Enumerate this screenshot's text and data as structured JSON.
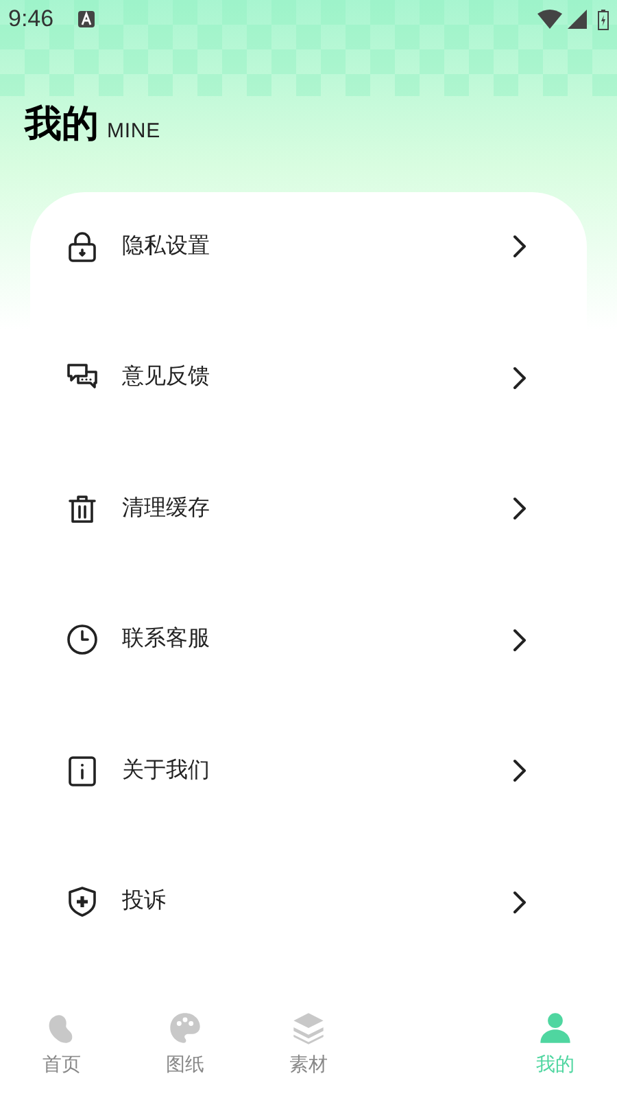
{
  "status_bar": {
    "time": "9:46"
  },
  "header": {
    "title": "我的",
    "subtitle": "MINE"
  },
  "menu": [
    {
      "label": "隐私设置"
    },
    {
      "label": "意见反馈"
    },
    {
      "label": "清理缓存"
    },
    {
      "label": "联系客服"
    },
    {
      "label": "关于我们"
    },
    {
      "label": "投诉"
    }
  ],
  "tab_bar": [
    {
      "label": "首页",
      "selected": false
    },
    {
      "label": "图纸",
      "selected": false
    },
    {
      "label": "素材",
      "selected": false
    },
    {
      "label": "我的",
      "selected": true
    }
  ]
}
